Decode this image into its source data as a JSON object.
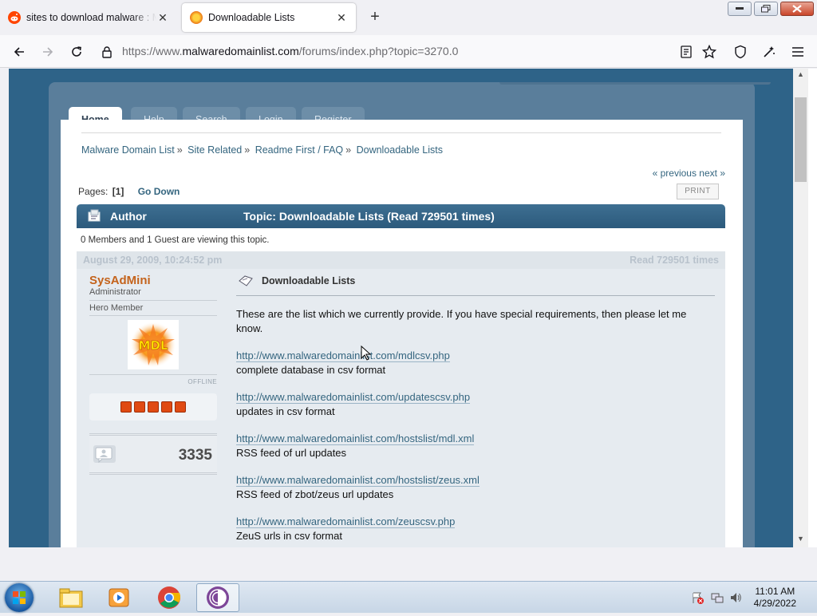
{
  "browser": {
    "tabs": [
      {
        "title": "sites to download malware : Ma",
        "active": false
      },
      {
        "title": "Downloadable Lists",
        "active": true
      }
    ],
    "url_prefix": "https://www.",
    "url_host": "malwaredomainlist.com",
    "url_path": "/forums/index.php?topic=3270.0"
  },
  "forum": {
    "menu": [
      "Home",
      "Help",
      "Search",
      "Login",
      "Register"
    ],
    "breadcrumb": [
      "Malware Domain List",
      "Site Related",
      "Readme First / FAQ",
      "Downloadable Lists"
    ],
    "prev_next": "« previous next »",
    "pages_label": "Pages:",
    "current_page": "[1]",
    "go_down": "Go Down",
    "print": "PRINT",
    "header_author": "Author",
    "header_topic": "Topic: Downloadable Lists  (Read 729501 times)",
    "viewing": "0 Members and 1 Guest are viewing this topic.",
    "post": {
      "date": "August 29, 2009, 10:24:52 pm",
      "reads": "Read 729501 times",
      "poster_name": "SysAdMini",
      "poster_role": "Administrator",
      "poster_rank": "Hero Member",
      "avatar_text": "MDL",
      "status": "OFFLINE",
      "post_count": "3335",
      "subject": "Downloadable Lists",
      "intro": "These are the list which we currently provide. If you have special requirements, then please let me know.",
      "items": [
        {
          "link": "http://www.malwaredomainlist.com/mdlcsv.php",
          "desc": "complete database in csv format"
        },
        {
          "link": "http://www.malwaredomainlist.com/updatescsv.php",
          "desc": "updates in csv format"
        },
        {
          "link": "http://www.malwaredomainlist.com/hostslist/mdl.xml",
          "desc": "RSS feed of url updates"
        },
        {
          "link": "http://www.malwaredomainlist.com/hostslist/zeus.xml",
          "desc": "RSS feed of zbot/zeus url updates"
        },
        {
          "link": "http://www.malwaredomainlist.com/zeuscsv.php",
          "desc": "ZeuS urls in csv format"
        }
      ]
    }
  },
  "taskbar": {
    "time": "11:01 AM",
    "date": "4/29/2022"
  },
  "colors": {
    "page_bg": "#2e6388",
    "accent_link": "#34657f",
    "poster_name": "#c4631c",
    "stars": "#e04a12"
  }
}
